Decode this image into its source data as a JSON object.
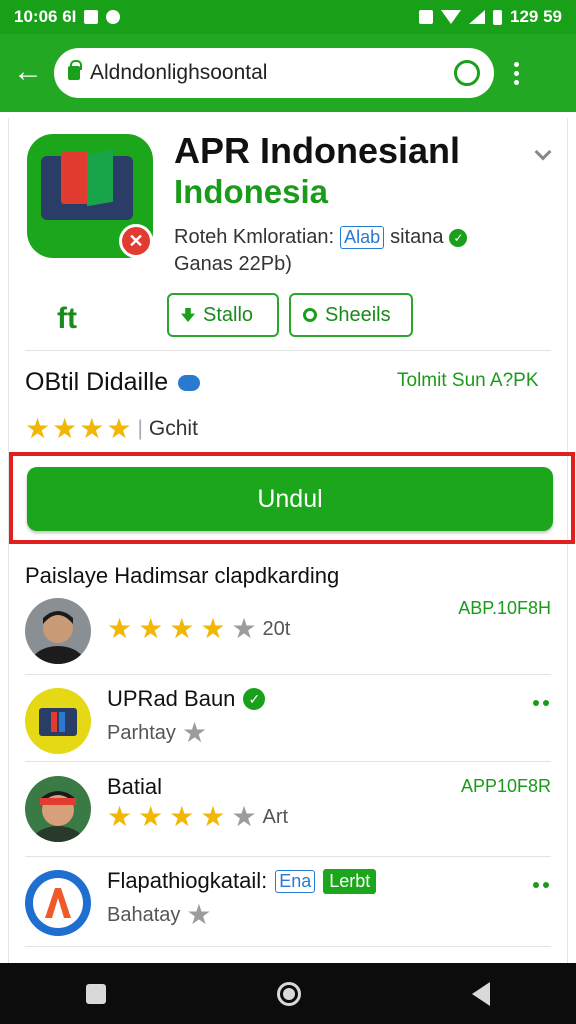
{
  "status_bar": {
    "time": "10:06 6I",
    "battery": "129 59"
  },
  "browser": {
    "url": "Aldndonlighsoontal"
  },
  "app": {
    "title": "APR Indonesianl",
    "subtitle": "Indonesia",
    "meta_prefix": "Roteh Kmloratian:",
    "meta_tag": "Alab",
    "meta_suffix": "sitana",
    "meta_line2": "Ganas 22Pb)",
    "chip1_label": "Stallo",
    "chip2_label": "Sheeils",
    "share_glyph": "ft"
  },
  "detail": {
    "title": "OBtil Didaille",
    "right_label": "Tolmit Sun A?PK",
    "rating_value": 4,
    "rating_text": "Gchit",
    "download_label": "Undul"
  },
  "section_title": "Paislaye Hadimsar clapdkarding",
  "list": [
    {
      "title": "",
      "sub": "20t",
      "right": "ABP.10F8H",
      "rating": 4,
      "avatar": "man-avatar"
    },
    {
      "title": "UPRad Baun",
      "sub": "Parhtay",
      "right": "",
      "rating": null,
      "avatar": "app-icon"
    },
    {
      "title": "Batial",
      "sub": "Art",
      "right": "APP10F8R",
      "rating": 4,
      "avatar": "man-headband-avatar"
    },
    {
      "title": "Flapathiogkatail:",
      "tag_blue": "Ena",
      "tag_green": "Lerbt",
      "sub": "Bahatay",
      "right": "",
      "rating": null,
      "avatar": "a-logo"
    }
  ],
  "colors": {
    "primary_green": "#23a823",
    "accent_red": "#e01f1f",
    "star": "#f2b705"
  }
}
